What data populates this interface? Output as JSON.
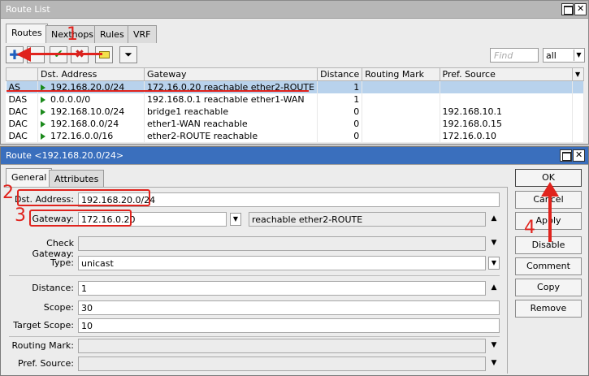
{
  "route_list": {
    "title": "Route List",
    "tabs": [
      "Routes",
      "Nexthops",
      "Rules",
      "VRF"
    ],
    "find_placeholder": "Find",
    "filter_value": "all",
    "columns": [
      "Dst. Address",
      "Gateway",
      "Distance",
      "Routing Mark",
      "Pref. Source"
    ],
    "rows": [
      {
        "flags": "AS",
        "dst": "192.168.20.0/24",
        "gateway": "172.16.0.20 reachable ether2-ROUTE",
        "distance": "1",
        "mark": "",
        "pref": ""
      },
      {
        "flags": "DAS",
        "dst": "0.0.0.0/0",
        "gateway": "192.168.0.1 reachable ether1-WAN",
        "distance": "1",
        "mark": "",
        "pref": ""
      },
      {
        "flags": "DAC",
        "dst": "192.168.10.0/24",
        "gateway": "bridge1 reachable",
        "distance": "0",
        "mark": "",
        "pref": "192.168.10.1"
      },
      {
        "flags": "DAC",
        "dst": "192.168.0.0/24",
        "gateway": "ether1-WAN reachable",
        "distance": "0",
        "mark": "",
        "pref": "192.168.0.15"
      },
      {
        "flags": "DAC",
        "dst": "172.16.0.0/16",
        "gateway": "ether2-ROUTE reachable",
        "distance": "0",
        "mark": "",
        "pref": "172.16.0.10"
      }
    ]
  },
  "route_edit": {
    "title": "Route <192.168.20.0/24>",
    "tabs": [
      "General",
      "Attributes"
    ],
    "labels": {
      "dst": "Dst. Address:",
      "gateway": "Gateway:",
      "check_gateway": "Check Gateway:",
      "type": "Type:",
      "distance": "Distance:",
      "scope": "Scope:",
      "target_scope": "Target Scope:",
      "routing_mark": "Routing Mark:",
      "pref_source": "Pref. Source:"
    },
    "values": {
      "dst": "192.168.20.0/24",
      "gateway": "172.16.0.20",
      "gateway_status": "reachable ether2-ROUTE",
      "type": "unicast",
      "distance": "1",
      "scope": "30",
      "target_scope": "10"
    },
    "buttons": {
      "ok": "OK",
      "cancel": "Cancel",
      "apply": "Apply",
      "disable": "Disable",
      "comment": "Comment",
      "copy": "Copy",
      "remove": "Remove"
    }
  },
  "annotations": [
    "1",
    "2",
    "3",
    "4"
  ],
  "colors": {
    "annotation": "#e0231d",
    "selected_row": "#b8d2ec",
    "edit_titlebar": "#3a6fbd"
  }
}
